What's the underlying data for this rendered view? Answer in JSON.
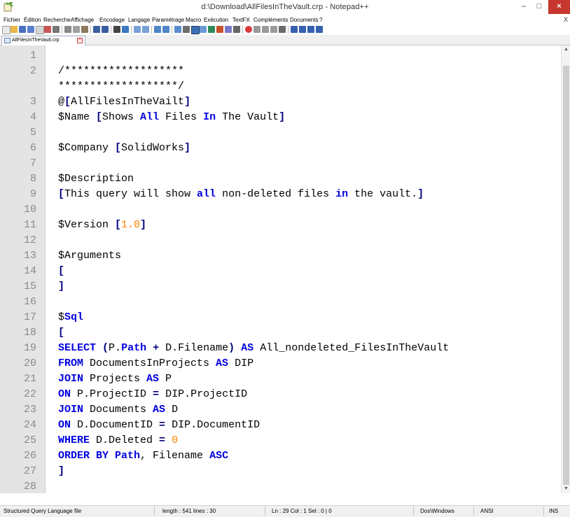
{
  "window": {
    "title": "d:\\Download\\AllFilesInTheVault.crp - Notepad++",
    "close_glyph": "×",
    "minimize_glyph": "–",
    "maximize_glyph": "□"
  },
  "menu": {
    "items": [
      "Fichier",
      "Édition",
      "Recherche",
      "Affichage",
      "Encodage",
      "Langage",
      "Paramétrage",
      "Macro",
      "Exécution",
      "TextFX",
      "Compléments",
      "Documents",
      "?"
    ],
    "close_glyph": "X"
  },
  "tab": {
    "label": "AllFilesInTheVault.crp",
    "close_glyph": "×"
  },
  "editor": {
    "lines": [
      {
        "n": "1",
        "segs": []
      },
      {
        "n": "2",
        "segs": [
          {
            "t": "/*******************",
            "c": ""
          }
        ]
      },
      {
        "n": "",
        "segs": [
          {
            "t": "*******************/",
            "c": ""
          }
        ]
      },
      {
        "n": "3",
        "segs": [
          {
            "t": "@",
            "c": ""
          },
          {
            "t": "[",
            "c": "brk"
          },
          {
            "t": "AllFilesInTheVailt",
            "c": ""
          },
          {
            "t": "]",
            "c": "brk"
          }
        ]
      },
      {
        "n": "4",
        "segs": [
          {
            "t": "$Name ",
            "c": ""
          },
          {
            "t": "[",
            "c": "brk"
          },
          {
            "t": "Shows ",
            "c": ""
          },
          {
            "t": "All",
            "c": "kw"
          },
          {
            "t": " Files ",
            "c": ""
          },
          {
            "t": "In",
            "c": "kw"
          },
          {
            "t": " The Vault",
            "c": ""
          },
          {
            "t": "]",
            "c": "brk"
          }
        ]
      },
      {
        "n": "5",
        "segs": []
      },
      {
        "n": "6",
        "segs": [
          {
            "t": "$Company ",
            "c": ""
          },
          {
            "t": "[",
            "c": "brk"
          },
          {
            "t": "SolidWorks",
            "c": ""
          },
          {
            "t": "]",
            "c": "brk"
          }
        ]
      },
      {
        "n": "7",
        "segs": []
      },
      {
        "n": "8",
        "segs": [
          {
            "t": "$Description",
            "c": ""
          }
        ]
      },
      {
        "n": "9",
        "segs": [
          {
            "t": "[",
            "c": "brk"
          },
          {
            "t": "This query will show ",
            "c": ""
          },
          {
            "t": "all",
            "c": "kw"
          },
          {
            "t": " non-deleted files ",
            "c": ""
          },
          {
            "t": "in",
            "c": "kw"
          },
          {
            "t": " the vault.",
            "c": ""
          },
          {
            "t": "]",
            "c": "brk"
          }
        ]
      },
      {
        "n": "10",
        "segs": []
      },
      {
        "n": "11",
        "segs": [
          {
            "t": "$Version ",
            "c": ""
          },
          {
            "t": "[",
            "c": "brk"
          },
          {
            "t": "1.0",
            "c": "num"
          },
          {
            "t": "]",
            "c": "brk"
          }
        ]
      },
      {
        "n": "12",
        "segs": []
      },
      {
        "n": "13",
        "segs": [
          {
            "t": "$Arguments",
            "c": ""
          }
        ]
      },
      {
        "n": "14",
        "segs": [
          {
            "t": "[",
            "c": "brk"
          }
        ]
      },
      {
        "n": "15",
        "segs": [
          {
            "t": "]",
            "c": "brk"
          }
        ]
      },
      {
        "n": "16",
        "segs": []
      },
      {
        "n": "17",
        "segs": [
          {
            "t": "$",
            "c": ""
          },
          {
            "t": "Sql",
            "c": "kw"
          }
        ]
      },
      {
        "n": "18",
        "segs": [
          {
            "t": "[",
            "c": "brk"
          }
        ]
      },
      {
        "n": "19",
        "segs": [
          {
            "t": "SELECT",
            "c": "kw"
          },
          {
            "t": " ",
            "c": ""
          },
          {
            "t": "(",
            "c": "op"
          },
          {
            "t": "P.",
            "c": ""
          },
          {
            "t": "Path",
            "c": "kw"
          },
          {
            "t": " ",
            "c": ""
          },
          {
            "t": "+",
            "c": "op"
          },
          {
            "t": " D.Filename",
            "c": ""
          },
          {
            "t": ")",
            "c": "op"
          },
          {
            "t": " ",
            "c": ""
          },
          {
            "t": "AS",
            "c": "kw"
          },
          {
            "t": " All_nondeleted_FilesInTheVault",
            "c": ""
          }
        ]
      },
      {
        "n": "20",
        "segs": [
          {
            "t": "FROM",
            "c": "kw"
          },
          {
            "t": " DocumentsInProjects ",
            "c": ""
          },
          {
            "t": "AS",
            "c": "kw"
          },
          {
            "t": " DIP",
            "c": ""
          }
        ]
      },
      {
        "n": "21",
        "segs": [
          {
            "t": "JOIN",
            "c": "kw"
          },
          {
            "t": " Projects ",
            "c": ""
          },
          {
            "t": "AS",
            "c": "kw"
          },
          {
            "t": " P",
            "c": ""
          }
        ]
      },
      {
        "n": "22",
        "segs": [
          {
            "t": "ON",
            "c": "kw"
          },
          {
            "t": " P.ProjectID ",
            "c": ""
          },
          {
            "t": "=",
            "c": "op"
          },
          {
            "t": " DIP.ProjectID",
            "c": ""
          }
        ]
      },
      {
        "n": "23",
        "segs": [
          {
            "t": "JOIN",
            "c": "kw"
          },
          {
            "t": " Documents ",
            "c": ""
          },
          {
            "t": "AS",
            "c": "kw"
          },
          {
            "t": " D",
            "c": ""
          }
        ]
      },
      {
        "n": "24",
        "segs": [
          {
            "t": "ON",
            "c": "kw"
          },
          {
            "t": " D.DocumentID ",
            "c": ""
          },
          {
            "t": "=",
            "c": "op"
          },
          {
            "t": " DIP.DocumentID",
            "c": ""
          }
        ]
      },
      {
        "n": "25",
        "segs": [
          {
            "t": "WHERE",
            "c": "kw"
          },
          {
            "t": " D.Deleted ",
            "c": ""
          },
          {
            "t": "=",
            "c": "op"
          },
          {
            "t": " ",
            "c": ""
          },
          {
            "t": "0",
            "c": "num"
          }
        ]
      },
      {
        "n": "26",
        "segs": [
          {
            "t": "ORDER BY",
            "c": "kw"
          },
          {
            "t": " ",
            "c": ""
          },
          {
            "t": "Path",
            "c": "kw"
          },
          {
            "t": ", Filename ",
            "c": ""
          },
          {
            "t": "ASC",
            "c": "kw"
          }
        ]
      },
      {
        "n": "27",
        "segs": [
          {
            "t": "]",
            "c": "brk"
          }
        ]
      },
      {
        "n": "28",
        "segs": []
      }
    ]
  },
  "statusbar": {
    "language": "Structured Query Language file",
    "length_lines": "length : 541   lines : 30",
    "position": "Ln : 29   Col : 1   Sel : 0 | 0",
    "eol": "Dos\\Windows",
    "encoding": "ANSI",
    "mode": "INS"
  }
}
